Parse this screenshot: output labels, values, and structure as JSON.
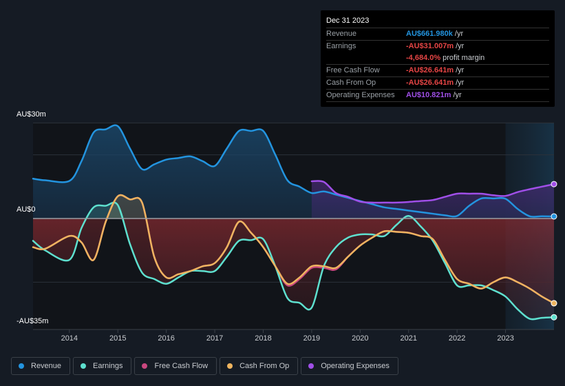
{
  "tooltip": {
    "date": "Dec 31 2023",
    "rows": [
      {
        "label": "Revenue",
        "value": "AU$661.980k",
        "suffix": "/yr",
        "color": "#2394df"
      },
      {
        "label": "Earnings",
        "value": "-AU$31.007m",
        "suffix": "/yr",
        "color": "#e64545"
      },
      {
        "label": "",
        "value": "-4,684.0%",
        "suffix": "profit margin",
        "color": "#e64545"
      },
      {
        "label": "Free Cash Flow",
        "value": "-AU$26.641m",
        "suffix": "/yr",
        "color": "#e64545"
      },
      {
        "label": "Cash From Op",
        "value": "-AU$26.641m",
        "suffix": "/yr",
        "color": "#e64545"
      },
      {
        "label": "Operating Expenses",
        "value": "AU$10.821m",
        "suffix": "/yr",
        "color": "#a04fe8"
      }
    ]
  },
  "legend": [
    {
      "label": "Revenue",
      "color": "#2394df"
    },
    {
      "label": "Earnings",
      "color": "#5ee0cf"
    },
    {
      "label": "Free Cash Flow",
      "color": "#c9477f"
    },
    {
      "label": "Cash From Op",
      "color": "#eeb45f"
    },
    {
      "label": "Operating Expenses",
      "color": "#a04fe8"
    }
  ],
  "chart_data": {
    "type": "line",
    "title": "",
    "xlabel": "",
    "ylabel": "",
    "y_tick_labels": [
      "AU$30m",
      "AU$0",
      "-AU$35m"
    ],
    "x_tick_labels": [
      "2014",
      "2015",
      "2016",
      "2017",
      "2018",
      "2019",
      "2020",
      "2021",
      "2022",
      "2023"
    ],
    "xlim": [
      2013.25,
      2024.0
    ],
    "ylim": [
      -35,
      30
    ],
    "grid": true,
    "legend_position": "bottom",
    "highlight_start": 2023.0,
    "series": [
      {
        "name": "Revenue",
        "color": "#2394df",
        "x": [
          2013.25,
          2013.5,
          2014.0,
          2014.25,
          2014.5,
          2014.75,
          2015.0,
          2015.25,
          2015.5,
          2015.75,
          2016.0,
          2016.25,
          2016.5,
          2016.75,
          2017.0,
          2017.25,
          2017.5,
          2017.75,
          2018.0,
          2018.25,
          2018.5,
          2018.75,
          2019.0,
          2019.25,
          2019.5,
          2019.75,
          2020.0,
          2020.25,
          2020.5,
          2020.75,
          2021.0,
          2021.25,
          2021.5,
          2021.75,
          2022.0,
          2022.25,
          2022.5,
          2022.75,
          2023.0,
          2023.25,
          2023.5,
          2023.75,
          2024.0
        ],
        "y": [
          12.5,
          12,
          11.8,
          18,
          27,
          28,
          29,
          22,
          15.5,
          17,
          18.5,
          19,
          19.5,
          18,
          16.5,
          22,
          27.5,
          27.5,
          27.5,
          20,
          12,
          10,
          8,
          8.5,
          7.5,
          6.5,
          5.5,
          4.5,
          3.5,
          3,
          2.5,
          2,
          1.5,
          1,
          0.8,
          4,
          6.3,
          6.3,
          6.2,
          3,
          0.7,
          0.7,
          0.66
        ]
      },
      {
        "name": "Earnings",
        "color": "#5ee0cf",
        "x": [
          2013.25,
          2013.5,
          2014.0,
          2014.25,
          2014.5,
          2014.75,
          2015.0,
          2015.25,
          2015.5,
          2015.75,
          2016.0,
          2016.25,
          2016.5,
          2016.75,
          2017.0,
          2017.25,
          2017.5,
          2017.75,
          2018.0,
          2018.25,
          2018.5,
          2018.75,
          2019.0,
          2019.25,
          2019.5,
          2019.75,
          2020.0,
          2020.25,
          2020.5,
          2020.75,
          2021.0,
          2021.25,
          2021.5,
          2021.75,
          2022.0,
          2022.25,
          2022.5,
          2022.75,
          2023.0,
          2023.25,
          2023.5,
          2023.75,
          2024.0
        ],
        "y": [
          -7,
          -10,
          -13,
          -3,
          3.5,
          4,
          4.2,
          -8,
          -17,
          -19,
          -20.5,
          -18.5,
          -16.5,
          -16.5,
          -16.5,
          -12,
          -7,
          -6.8,
          -6.5,
          -15,
          -25,
          -26.5,
          -28,
          -15,
          -9,
          -6,
          -5,
          -5,
          -5.5,
          -2,
          0.8,
          -2.5,
          -7,
          -14,
          -21,
          -21,
          -21,
          -22.5,
          -24.5,
          -28.5,
          -31.5,
          -31.2,
          -31
        ]
      },
      {
        "name": "Free Cash Flow",
        "color": "#c9477f",
        "x": [
          2013.25,
          2013.5,
          2014.0,
          2014.25,
          2014.5,
          2014.75,
          2015.0,
          2015.25,
          2015.5,
          2015.75,
          2016.0,
          2016.25,
          2016.5,
          2016.75,
          2017.0,
          2017.25,
          2017.5,
          2017.75,
          2018.0,
          2018.25,
          2018.5,
          2018.75,
          2019.0,
          2019.25,
          2019.5,
          2019.75,
          2020.0,
          2020.25,
          2020.5,
          2020.75,
          2021.0,
          2021.25,
          2021.5,
          2021.75,
          2022.0,
          2022.25,
          2022.5,
          2022.75,
          2023.0,
          2023.25,
          2023.5,
          2023.75,
          2024.0
        ],
        "y": [
          -9,
          -9.5,
          -5.5,
          -7.5,
          -13,
          -1,
          7,
          6,
          5,
          -12,
          -18.5,
          -17.5,
          -16.5,
          -15,
          -14,
          -9,
          -1,
          -4.5,
          -9,
          -15,
          -21,
          -19,
          -15.5,
          -15.5,
          -16,
          -12,
          -8.5,
          -6,
          -4,
          -4.2,
          -4.5,
          -5.5,
          -6.5,
          -13,
          -19,
          -20.5,
          -22,
          -20,
          -18.5,
          -20,
          -22,
          -24.5,
          -26.6
        ]
      },
      {
        "name": "Cash From Op",
        "color": "#eeb45f",
        "x": [
          2013.25,
          2013.5,
          2014.0,
          2014.25,
          2014.5,
          2014.75,
          2015.0,
          2015.25,
          2015.5,
          2015.75,
          2016.0,
          2016.25,
          2016.5,
          2016.75,
          2017.0,
          2017.25,
          2017.5,
          2017.75,
          2018.0,
          2018.25,
          2018.5,
          2018.75,
          2019.0,
          2019.25,
          2019.5,
          2019.75,
          2020.0,
          2020.25,
          2020.5,
          2020.75,
          2021.0,
          2021.25,
          2021.5,
          2021.75,
          2022.0,
          2022.25,
          2022.5,
          2022.75,
          2023.0,
          2023.25,
          2023.5,
          2023.75,
          2024.0
        ],
        "y": [
          -9,
          -9.5,
          -5.5,
          -7.5,
          -13,
          -1,
          7,
          6,
          5,
          -12,
          -18.5,
          -17.5,
          -16.5,
          -15,
          -14,
          -9,
          -1,
          -4.5,
          -9,
          -15,
          -20.5,
          -18.5,
          -15,
          -15,
          -15.5,
          -12,
          -8.5,
          -6,
          -4,
          -4.2,
          -4.5,
          -5.5,
          -6.5,
          -13,
          -19,
          -20.5,
          -22,
          -20,
          -18.5,
          -20,
          -22,
          -24.5,
          -26.6
        ]
      },
      {
        "name": "Operating Expenses",
        "color": "#a04fe8",
        "x": [
          2019.0,
          2019.25,
          2019.5,
          2019.75,
          2020.0,
          2020.25,
          2020.5,
          2020.75,
          2021.0,
          2021.25,
          2021.5,
          2021.75,
          2022.0,
          2022.25,
          2022.5,
          2022.75,
          2023.0,
          2023.25,
          2023.5,
          2023.75,
          2024.0
        ],
        "y": [
          11.7,
          11.5,
          8,
          6.8,
          5.3,
          5,
          5,
          5,
          5.2,
          5.5,
          5.8,
          6.8,
          7.8,
          7.8,
          7.8,
          7.3,
          7.1,
          8.3,
          9.2,
          10,
          10.8
        ]
      }
    ]
  }
}
